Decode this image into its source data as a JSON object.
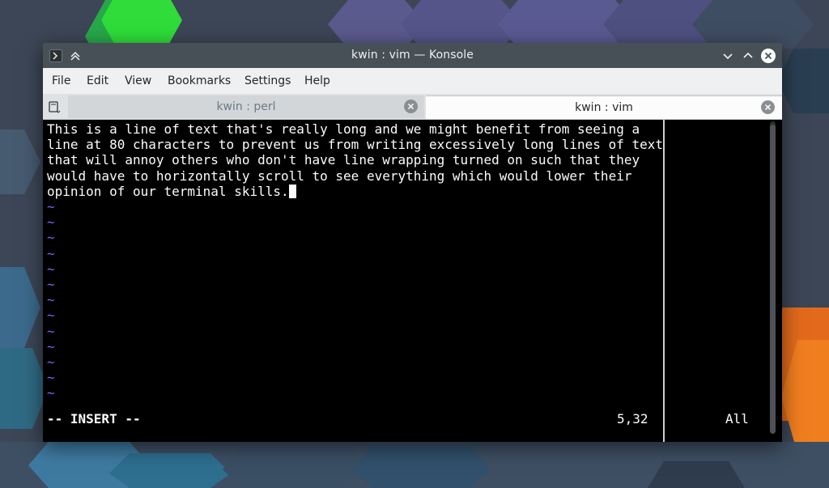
{
  "window": {
    "title": "kwin : vim — Konsole"
  },
  "menubar": {
    "items": [
      "File",
      "Edit",
      "View",
      "Bookmarks",
      "Settings",
      "Help"
    ]
  },
  "tabs": [
    {
      "label": "kwin : perl",
      "active": false
    },
    {
      "label": "kwin : vim",
      "active": true
    }
  ],
  "editor": {
    "lines": [
      "This is a line of text that's really long and we might benefit from seeing a",
      "line at 80 characters to prevent us from writing excessively long lines of text",
      "that will annoy others who don't have line wrapping turned on such that they",
      "would have to horizontally scroll to see everything which would lower their",
      "opinion of our terminal skills."
    ],
    "tilde": "~",
    "mode": "-- INSERT --",
    "position": "5,32",
    "scroll": "All"
  },
  "colors": {
    "titlebar": "#475057",
    "terminal_bg": "#000000",
    "terminal_fg": "#fcfcfc",
    "tilde": "#6b6bff"
  },
  "icons": {
    "app": "terminal-icon",
    "keep_above": "keep-above-icon",
    "minimize": "chevron-down-icon",
    "maximize": "chevron-up-icon",
    "close": "close-icon",
    "new_tab": "new-tab-icon"
  }
}
